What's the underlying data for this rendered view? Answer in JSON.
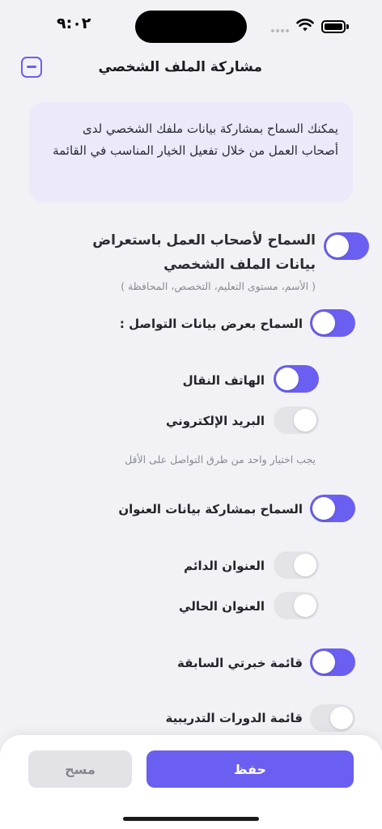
{
  "status_bar": {
    "time": "٩:٠٢"
  },
  "header": {
    "title": "مشاركة الملف الشخصي"
  },
  "info": {
    "text": "يمكنك السماح بمشاركة بيانات ملفك الشخصي لدى أصحاب العمل من خلال تفعيل الخيار المناسب في القائمة"
  },
  "main_toggle": {
    "label": "السماح لأصحاب العمل باستعراض بيانات الملف الشخصي",
    "sub": "( الأسم، مستوى التعليم، التخصص، المحافظة )",
    "on": true
  },
  "contact": {
    "label": "السماح بعرض بيانات التواصل :",
    "on": true,
    "options": [
      {
        "label": "الهاتف النقال",
        "on": true
      },
      {
        "label": "البريد الإلكتروني",
        "on": false
      }
    ],
    "hint": "يجب اختيار واحد من طرق التواصل على الأقل"
  },
  "address": {
    "label": "السماح بمشاركة بيانات العنوان",
    "on": true,
    "options": [
      {
        "label": "العنوان الدائم",
        "on": false
      },
      {
        "label": "العنوان الحالي",
        "on": false
      }
    ]
  },
  "experience": {
    "label": "قائمة خبرتي السابقة",
    "on": true
  },
  "courses": {
    "label": "قائمة الدورات التدريبية",
    "on": false
  },
  "actions": {
    "save": "حفظ",
    "clear": "مسح"
  },
  "colors": {
    "accent": "#6a5ff0",
    "toggle_off": "#e3e3e8",
    "info_bg": "#ebe9fa"
  }
}
